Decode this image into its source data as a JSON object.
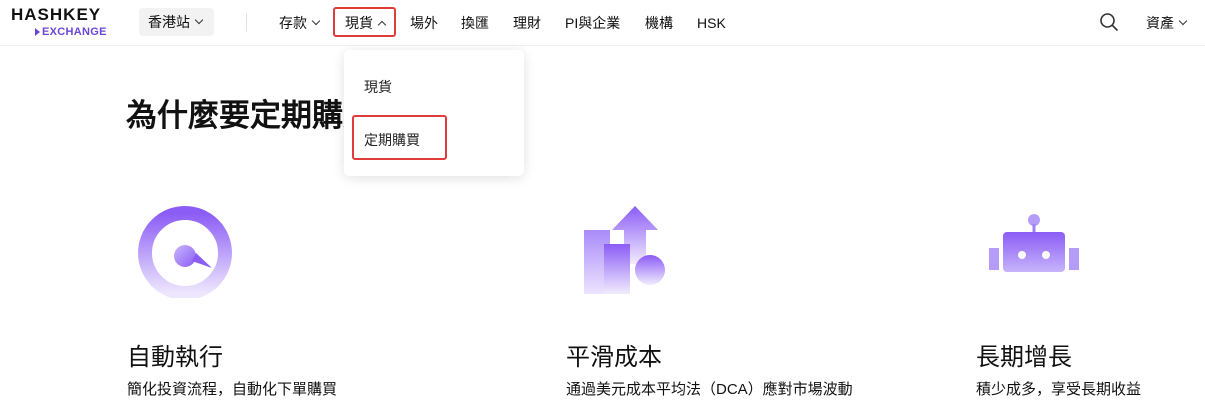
{
  "header": {
    "logo": {
      "main": "HASHKEY",
      "sub": "EXCHANGE"
    },
    "region": {
      "label": "香港站"
    },
    "nav": [
      {
        "label": "存款",
        "has_dropdown": true
      },
      {
        "label": "現貨",
        "has_dropdown": true,
        "active": true
      },
      {
        "label": "場外"
      },
      {
        "label": "換匯"
      },
      {
        "label": "理財"
      },
      {
        "label": "PI與企業"
      },
      {
        "label": "機構"
      },
      {
        "label": "HSK"
      }
    ],
    "search_icon": "search-icon",
    "assets": {
      "label": "資產"
    }
  },
  "dropdown": {
    "items": [
      {
        "label": "現貨"
      },
      {
        "label": "定期購買",
        "highlighted": true
      }
    ]
  },
  "main": {
    "headline": "為什麼要定期購買",
    "features": [
      {
        "icon": "clock-icon",
        "title": "自動執行",
        "desc": "簡化投資流程，自動化下單購買"
      },
      {
        "icon": "growth-chart-icon",
        "title": "平滑成本",
        "desc": "通過美元成本平均法（DCA）應對市場波動"
      },
      {
        "icon": "robot-icon",
        "title": "長期增長",
        "desc": "積少成多，享受長期收益"
      }
    ]
  },
  "colors": {
    "accent": "#8b5cf6",
    "brand_purple": "#6a47d6",
    "highlight_border": "#e03c3c"
  }
}
